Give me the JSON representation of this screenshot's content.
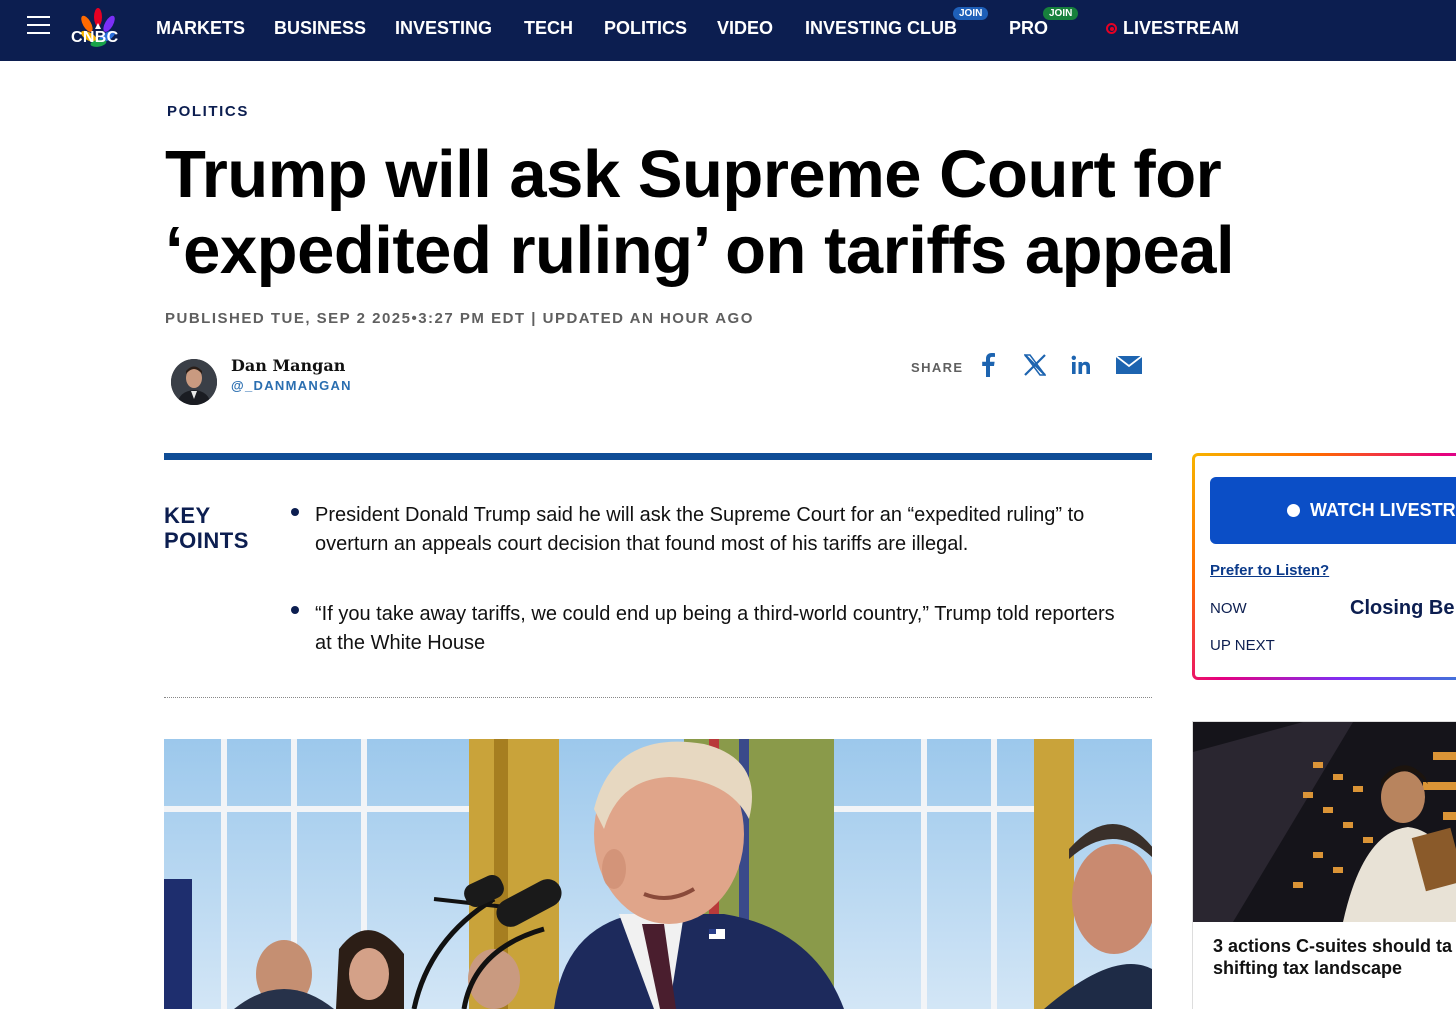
{
  "nav": {
    "brand": "CNBC",
    "items": [
      "MARKETS",
      "BUSINESS",
      "INVESTING",
      "TECH",
      "POLITICS",
      "VIDEO",
      "INVESTING CLUB",
      "PRO",
      "LIVESTREAM"
    ],
    "join_badge": "JOIN",
    "colors": {
      "background": "#0c1e50",
      "live": "#e60023"
    }
  },
  "article": {
    "section": "POLITICS",
    "headline_line1": "Trump will ask Supreme Court for",
    "headline_line2": "‘expedited ruling’ on tariffs appeal",
    "published": "PUBLISHED TUE, SEP 2 2025•3:27 PM EDT | UPDATED AN HOUR AGO",
    "author": {
      "name": "Dan Mangan",
      "handle": "@_DANMANGAN"
    },
    "share": {
      "label": "SHARE",
      "icons": [
        "facebook-icon",
        "x-icon",
        "linkedin-icon",
        "email-icon"
      ]
    },
    "key_points": {
      "title_line1": "KEY",
      "title_line2": "POINTS",
      "items": [
        "President Donald Trump said he will ask the Supreme Court for an “expedited ruling” to overturn an appeals court decision that found most of his tariffs are illegal.",
        "“If you take away tariffs, we could end up being a third-world country,” Trump told reporters at the White House"
      ]
    }
  },
  "sidebar": {
    "watch_label": "WATCH LIVESTR",
    "prefer_listen": "Prefer to Listen?",
    "now_label": "NOW",
    "now_show": "Closing Be",
    "up_next_label": "UP NEXT",
    "promo_title_line1": "3 actions C-suites should ta",
    "promo_title_line2": "shifting tax landscape"
  }
}
